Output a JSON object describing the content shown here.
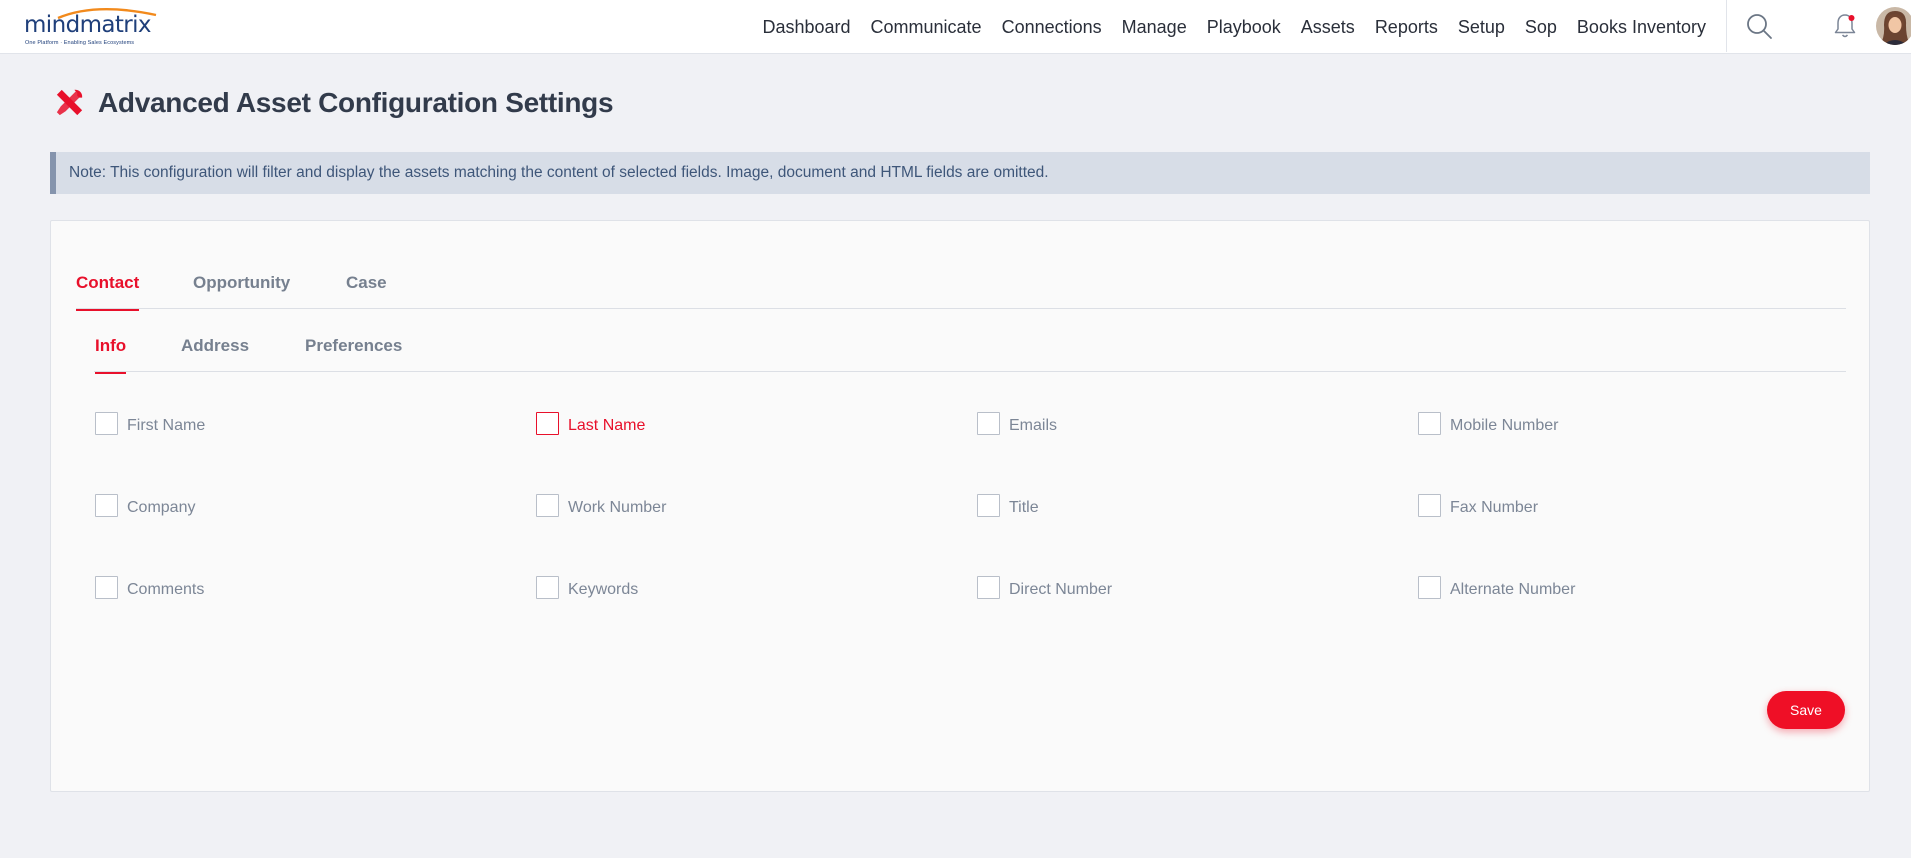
{
  "header": {
    "logo_text": "mindmatrix",
    "logo_tagline": "One Platform · Enabling Sales Ecosystems",
    "nav": [
      "Dashboard",
      "Communicate",
      "Connections",
      "Manage",
      "Playbook",
      "Assets",
      "Reports",
      "Setup",
      "Sop",
      "Books Inventory"
    ],
    "icons": [
      "search-icon",
      "bell-icon"
    ],
    "notification_dot_color": "#e8102b"
  },
  "page": {
    "title": "Advanced Asset Configuration Settings",
    "title_icon": "tools-icon",
    "note": "Note: This configuration will filter and display the assets matching the content of selected fields. Image, document and HTML fields are omitted."
  },
  "tabs": {
    "primary": [
      {
        "label": "Contact",
        "active": true
      },
      {
        "label": "Opportunity",
        "active": false
      },
      {
        "label": "Case",
        "active": false
      }
    ],
    "secondary": [
      {
        "label": "Info",
        "active": true
      },
      {
        "label": "Address",
        "active": false
      },
      {
        "label": "Preferences",
        "active": false
      }
    ]
  },
  "fields": [
    {
      "label": "First Name",
      "checked": false
    },
    {
      "label": "Last Name",
      "checked": false,
      "focused": true
    },
    {
      "label": "Emails",
      "checked": false
    },
    {
      "label": "Mobile Number",
      "checked": false
    },
    {
      "label": "Company",
      "checked": false
    },
    {
      "label": "Work Number",
      "checked": false
    },
    {
      "label": "Title",
      "checked": false
    },
    {
      "label": "Fax Number",
      "checked": false
    },
    {
      "label": "Comments",
      "checked": false
    },
    {
      "label": "Keywords",
      "checked": false
    },
    {
      "label": "Direct Number",
      "checked": false
    },
    {
      "label": "Alternate Number",
      "checked": false
    }
  ],
  "actions": {
    "save_label": "Save"
  },
  "colors": {
    "accent": "#e8102b",
    "note_bg": "#d7dde7",
    "note_text": "#3e5679",
    "page_bg": "#f0f1f5"
  }
}
